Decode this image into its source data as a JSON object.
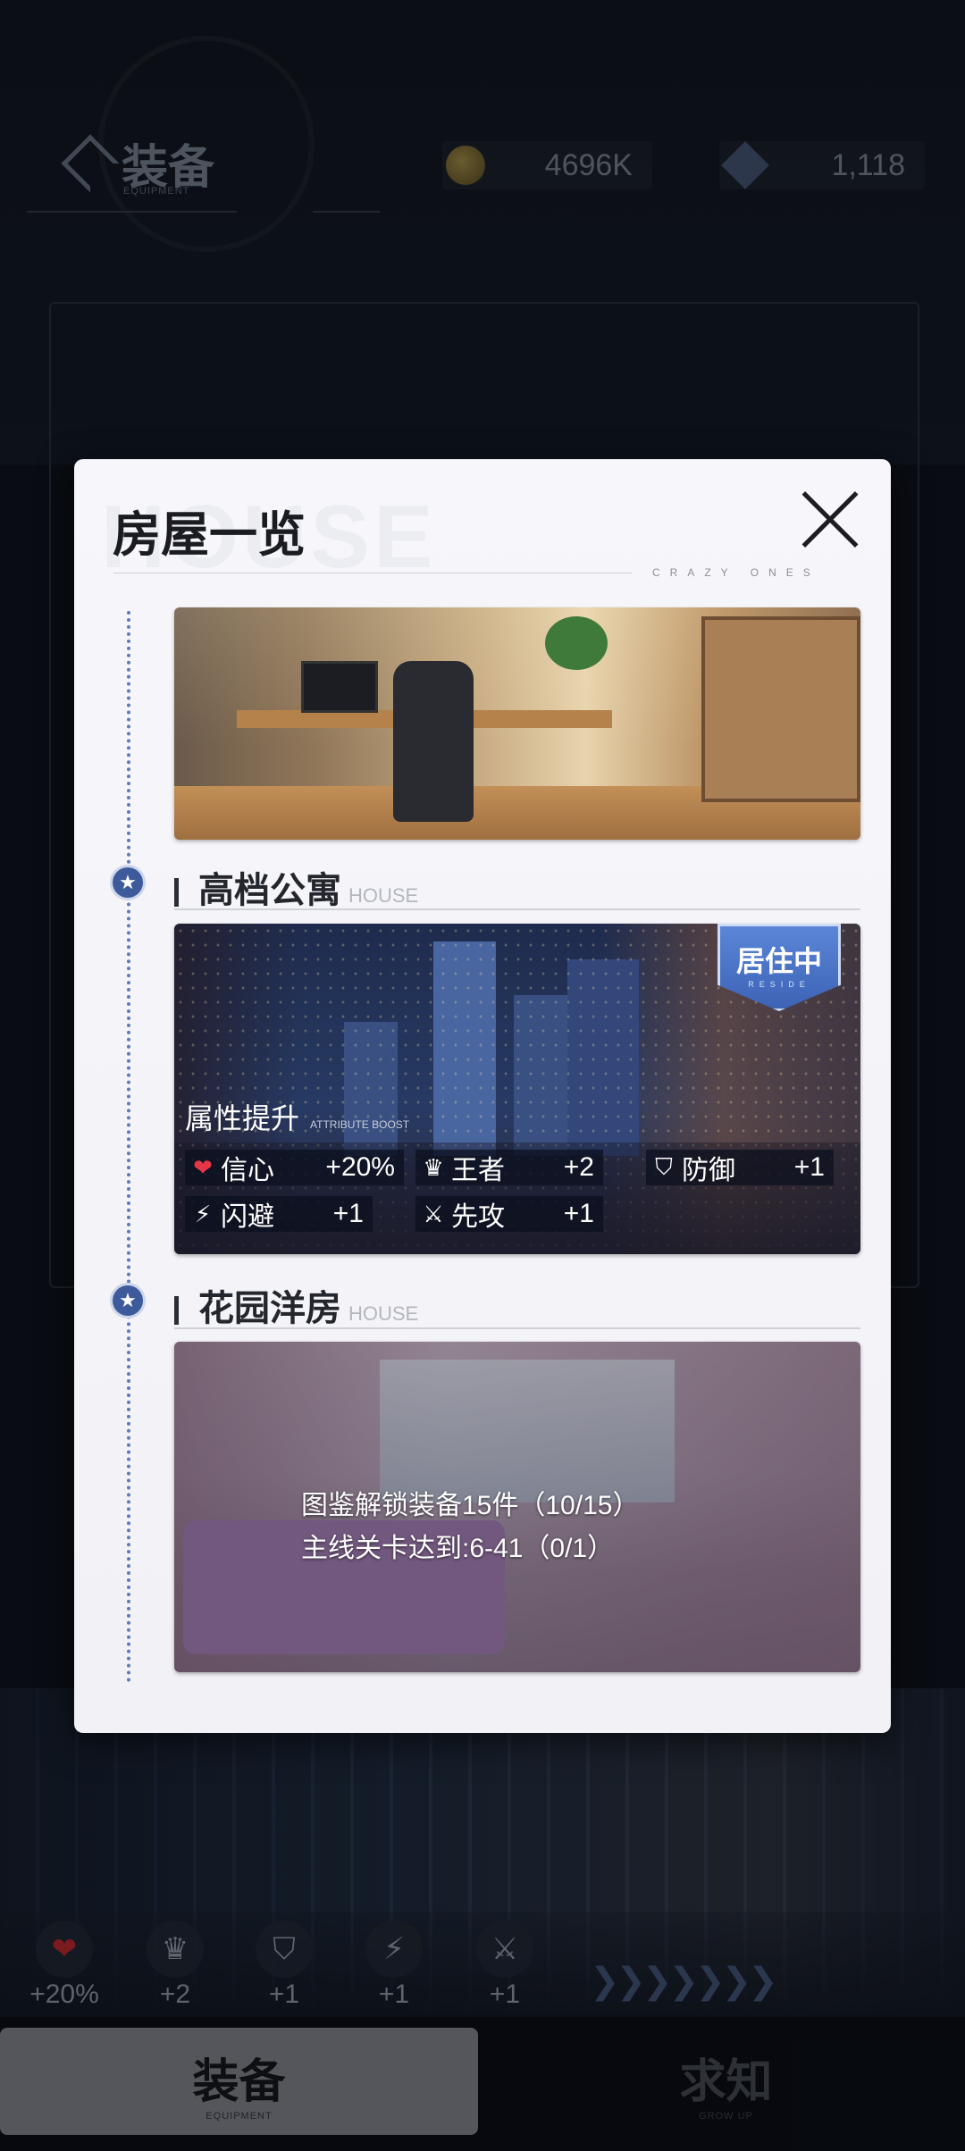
{
  "header": {
    "title": "装备",
    "subtitle": "EQUIPMENT",
    "gold": "4696K",
    "gems": "1,118"
  },
  "stats": [
    {
      "icon": "heart-icon",
      "glyph": "❤",
      "value": "+20%"
    },
    {
      "icon": "crown-icon",
      "glyph": "♛",
      "value": "+2"
    },
    {
      "icon": "shield-icon",
      "glyph": "⛉",
      "value": "+1"
    },
    {
      "icon": "lightning-icon",
      "glyph": "⚡",
      "value": "+1"
    },
    {
      "icon": "crossed-swords-icon",
      "glyph": "⚔",
      "value": "+1"
    }
  ],
  "bottom_nav": {
    "tabs": [
      {
        "label": "装备",
        "sub": "EQUIPMENT",
        "active": true
      },
      {
        "label": "求知",
        "sub": "GROW UP",
        "active": false
      }
    ]
  },
  "modal": {
    "watermark": "HOUSE",
    "title": "房屋一览",
    "tagline": "CRAZY ONES",
    "houses": [
      {
        "name": "高档公寓",
        "en": "HOUSE",
        "badge": "居住中",
        "badge_en": "RESIDE",
        "attr_title": "属性提升",
        "attr_en": "ATTRIBUTE BOOST",
        "attributes": [
          {
            "icon": "heart-icon",
            "glyph": "❤",
            "name": "信心",
            "value": "+20%"
          },
          {
            "icon": "crown-icon",
            "glyph": "♛",
            "name": "王者",
            "value": "+2"
          },
          {
            "icon": "shield-icon",
            "glyph": "⛉",
            "name": "防御",
            "value": "+1"
          },
          {
            "icon": "lightning-icon",
            "glyph": "⚡",
            "name": "闪避",
            "value": "+1"
          },
          {
            "icon": "crossed-swords-icon",
            "glyph": "⚔",
            "name": "先攻",
            "value": "+1"
          }
        ]
      },
      {
        "name": "花园洋房",
        "en": "HOUSE",
        "conditions": [
          "图鉴解锁装备15件（10/15）",
          "主线关卡达到:6-41（0/1）"
        ]
      }
    ]
  },
  "colors": {
    "accent_blue": "#3d63b5",
    "heart_red": "#e63645",
    "timeline_blue": "#5d7cb4"
  }
}
